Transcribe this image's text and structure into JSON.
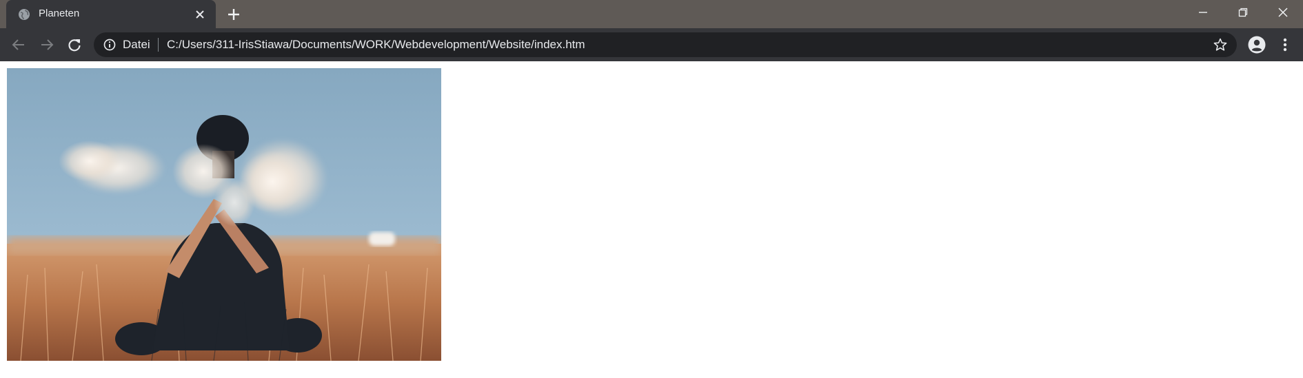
{
  "browser": {
    "tab": {
      "title": "Planeten",
      "favicon": "globe-icon"
    },
    "new_tab_icon": "plus-icon",
    "window_controls": [
      "minimize-icon",
      "restore-icon",
      "close-icon"
    ],
    "toolbar": {
      "back_icon": "arrow-left-icon",
      "forward_icon": "arrow-right-icon",
      "reload_icon": "reload-icon",
      "address": {
        "info_icon": "info-icon",
        "scheme_label": "Datei",
        "url": "C:/Users/311-IrisStiawa/Documents/WORK/Webdevelopment/Website/index.htm"
      },
      "bookmark_icon": "star-icon",
      "profile_icon": "account-circle-icon",
      "menu_icon": "more-vert-icon"
    },
    "colors": {
      "titlebar": "#5f5a56",
      "toolbar": "#35363a",
      "omnibox": "#202124",
      "text": "#e8eaed"
    }
  },
  "page": {
    "image": {
      "subject": "person sitting in a golden field throwing white powder against a blue sky"
    }
  }
}
